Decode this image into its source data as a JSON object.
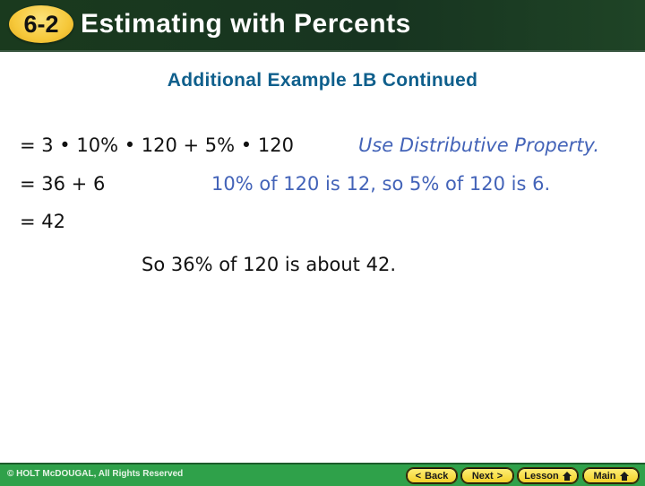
{
  "header": {
    "lesson_number": "6-2",
    "title": "Estimating with Percents"
  },
  "subtitle": "Additional Example 1B Continued",
  "steps": [
    {
      "expression": "= 3 • 10% • 120 + 5% • 120",
      "note": "Use Distributive Property.",
      "note_style": "italic"
    },
    {
      "expression": "= 36 + 6",
      "note": "10% of 120 is 12, so 5% of 120 is 6.",
      "note_style": "normal"
    },
    {
      "expression": "= 42",
      "note": ""
    }
  ],
  "conclusion": "So 36% of 120 is about 42.",
  "footer": {
    "copyright": "© HOLT McDOUGAL, All Rights Reserved",
    "nav": {
      "back": "Back",
      "next": "Next",
      "lesson": "Lesson",
      "main": "Main"
    }
  },
  "colors": {
    "header_bg": "#173420",
    "badge": "#f6c83a",
    "subtitle": "#0f5f8c",
    "note": "#4363b8",
    "footer_bg": "#2fa14a",
    "nav_button": "#f2cf23"
  }
}
